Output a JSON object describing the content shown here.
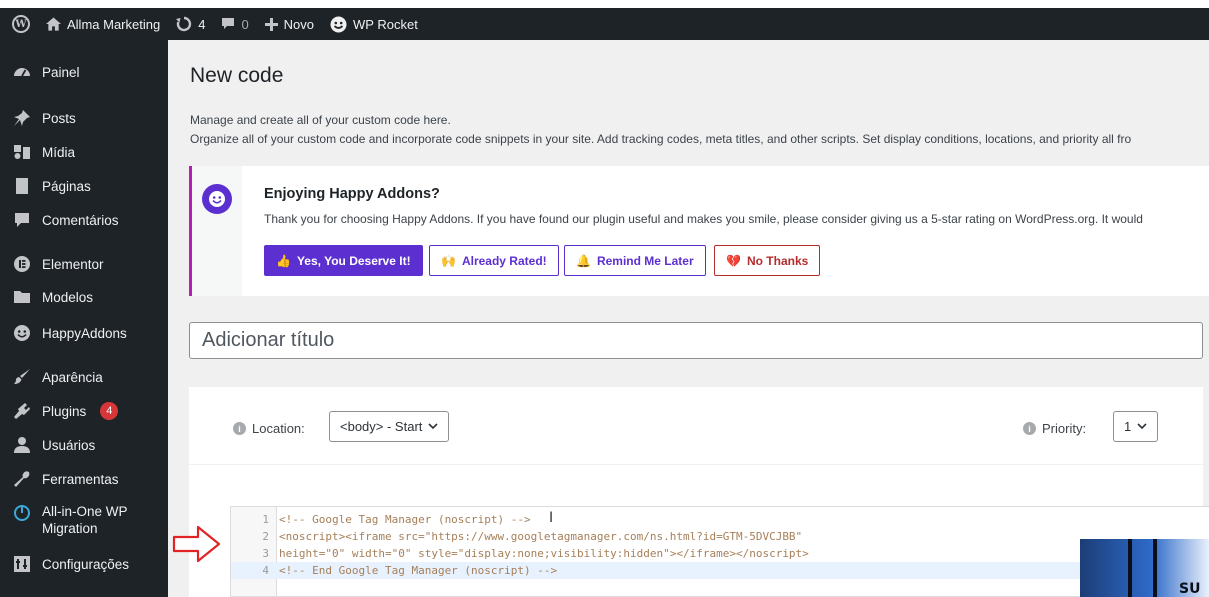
{
  "adminbar": {
    "site_name": "Allma Marketing",
    "updates_count": "4",
    "comments_count": "0",
    "new_label": "Novo",
    "wp_rocket_label": "WP Rocket"
  },
  "sidebar": {
    "items": [
      {
        "label": "Painel",
        "icon": "dashboard-icon"
      },
      {
        "label": "Posts",
        "icon": "pin-icon"
      },
      {
        "label": "Mídia",
        "icon": "media-icon"
      },
      {
        "label": "Páginas",
        "icon": "page-icon"
      },
      {
        "label": "Comentários",
        "icon": "comment-icon"
      },
      {
        "label": "Elementor",
        "icon": "elementor-icon"
      },
      {
        "label": "Modelos",
        "icon": "folder-icon"
      },
      {
        "label": "HappyAddons",
        "icon": "happy-icon"
      },
      {
        "label": "Aparência",
        "icon": "brush-icon"
      },
      {
        "label": "Plugins",
        "icon": "plugin-icon",
        "badge": "4"
      },
      {
        "label": "Usuários",
        "icon": "users-icon"
      },
      {
        "label": "Ferramentas",
        "icon": "wrench-icon"
      },
      {
        "label": "All-in-One WP",
        "label2": "Migration",
        "icon": "migration-icon"
      },
      {
        "label": "Configurações",
        "icon": "settings-icon"
      }
    ]
  },
  "main": {
    "title": "New code",
    "desc1": "Manage and create all of your custom code here.",
    "desc2": "Organize all of your custom code and incorporate code snippets in your site. Add tracking codes, meta titles, and other scripts. Set display conditions, locations, and priority all fro"
  },
  "notice": {
    "title": "Enjoying Happy Addons?",
    "text": "Thank you for choosing Happy Addons. If you have found our plugin useful and makes you smile, please consider giving us a 5-star rating on WordPress.org. It would",
    "btn_yes": "Yes, You Deserve It!",
    "btn_rated": "Already Rated!",
    "btn_remind": "Remind Me Later",
    "btn_no": "No Thanks"
  },
  "title_input": {
    "placeholder": "Adicionar título"
  },
  "panel": {
    "location_label": "Location:",
    "location_value": "<body> - Start",
    "priority_label": "Priority:",
    "priority_value": "1"
  },
  "code": {
    "lines": [
      {
        "n": "1",
        "text": "<!-- Google Tag Manager (noscript) -->"
      },
      {
        "n": "2",
        "text": "<noscript><iframe src=\"https://www.googletagmanager.com/ns.html?id=GTM-5DVCJBB\""
      },
      {
        "n": "3",
        "text": "height=\"0\" width=\"0\" style=\"display:none;visibility:hidden\"></iframe></noscript>"
      },
      {
        "n": "4",
        "text": "<!-- End Google Tag Manager (noscript) -->"
      }
    ]
  },
  "overlay": {
    "text": "SU"
  },
  "colors": {
    "sidebar_bg": "#1d2327",
    "accent_purple": "#5c2fd1",
    "notice_border": "#b91cb5",
    "danger": "#d63638"
  }
}
